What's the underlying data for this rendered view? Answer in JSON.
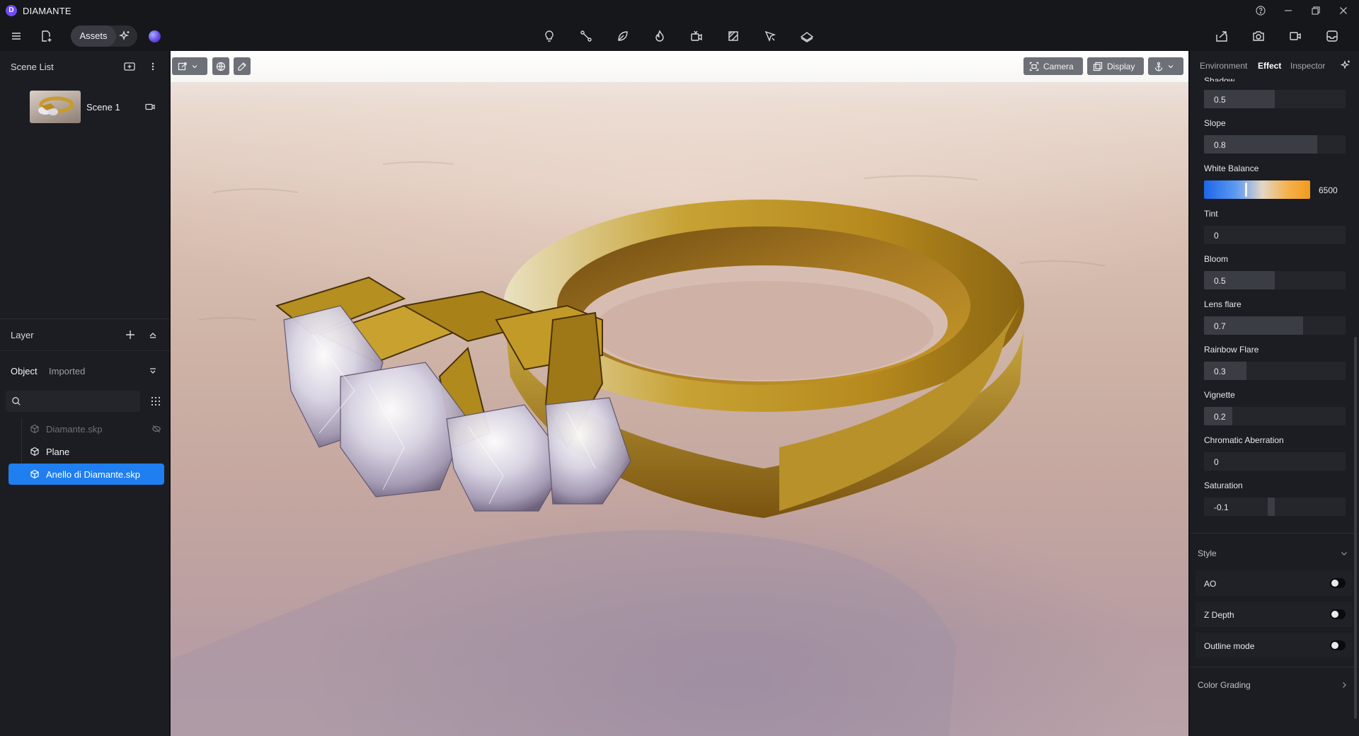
{
  "app": {
    "logo_letter": "D",
    "title": "DIAMANTE"
  },
  "toolbar": {
    "assets_label": "Assets"
  },
  "scene_list": {
    "title": "Scene List",
    "scenes": [
      {
        "name": "Scene 1"
      }
    ]
  },
  "layer": {
    "title": "Layer",
    "tabs": [
      {
        "label": "Object",
        "active": true
      },
      {
        "label": "Imported",
        "active": false
      }
    ],
    "search_placeholder": "",
    "items": [
      {
        "label": "Diamante.skp",
        "hidden": true,
        "selected": false
      },
      {
        "label": "Plane",
        "hidden": false,
        "selected": false
      },
      {
        "label": "Anello di Diamante.skp",
        "hidden": false,
        "selected": true
      }
    ]
  },
  "viewport": {
    "camera_label": "Camera",
    "display_label": "Display"
  },
  "right_panel": {
    "tabs": [
      {
        "label": "Environment",
        "active": false
      },
      {
        "label": "Effect",
        "active": true
      },
      {
        "label": "Inspector",
        "active": false
      }
    ],
    "partial_label": "Shadow",
    "effects": {
      "shadow_value": "0.5",
      "slope_label": "Slope",
      "slope_value": "0.8",
      "white_balance_label": "White Balance",
      "white_balance_value": "6500",
      "tint_label": "Tint",
      "tint_value": "0",
      "bloom_label": "Bloom",
      "bloom_value": "0.5",
      "lens_flare_label": "Lens flare",
      "lens_flare_value": "0.7",
      "rainbow_flare_label": "Rainbow Flare",
      "rainbow_flare_value": "0.3",
      "vignette_label": "Vignette",
      "vignette_value": "0.2",
      "chromatic_label": "Chromatic Aberration",
      "chromatic_value": "0",
      "saturation_label": "Saturation",
      "saturation_value": "-0.1"
    },
    "style": {
      "title": "Style",
      "toggles": [
        {
          "label": "AO",
          "on": false
        },
        {
          "label": "Z Depth",
          "on": false
        },
        {
          "label": "Outline mode",
          "on": false
        }
      ]
    },
    "color_grading_label": "Color Grading"
  },
  "colors": {
    "accent": "#1f7ef0",
    "panel": "#1c1d22",
    "gold": "#c99b2a"
  }
}
